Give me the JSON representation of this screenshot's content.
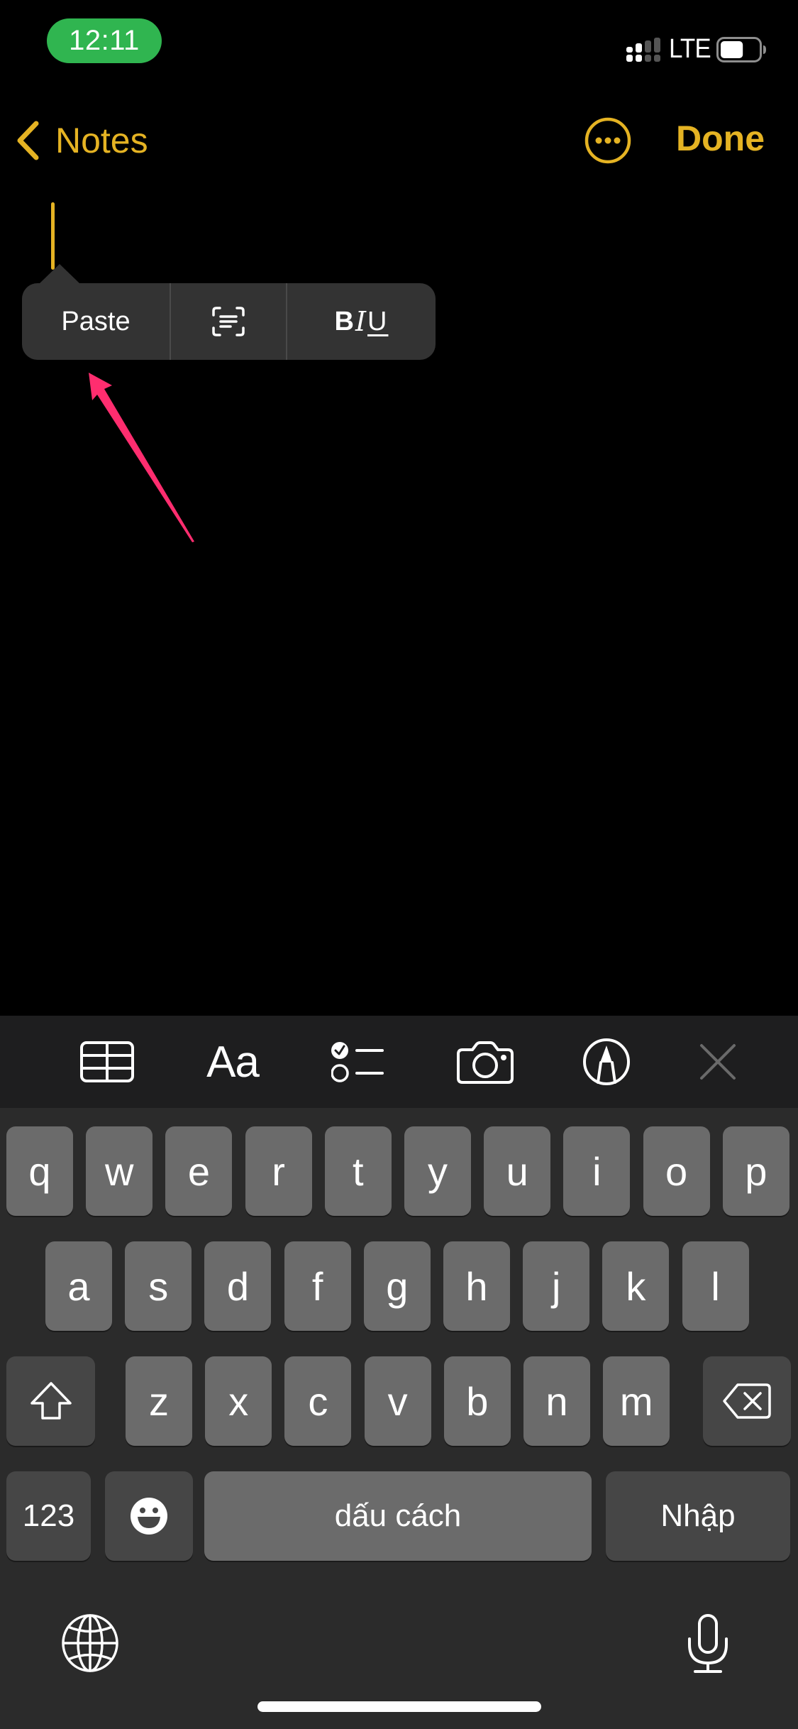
{
  "status_bar": {
    "time": "12:11",
    "network": "LTE",
    "signal_bars_active": 2,
    "signal_bars_total": 4,
    "battery_level": 0.6,
    "time_pill_color": "#30b550"
  },
  "nav": {
    "back_label": "Notes",
    "back_icon": "chevron-left-icon",
    "more_icon": "ellipsis-circle-icon",
    "done_label": "Done",
    "accent_color": "#e5b323"
  },
  "edit_menu": {
    "paste_label": "Paste",
    "scan_text_icon": "scan-text-icon",
    "format": {
      "bold": "B",
      "italic": "I",
      "underline": "U"
    }
  },
  "annotation": {
    "arrow_color": "#ff2d6f",
    "points_to": "Paste"
  },
  "format_toolbar": {
    "items": [
      {
        "name": "table",
        "icon": "table-icon"
      },
      {
        "name": "text-style",
        "label": "Aa"
      },
      {
        "name": "checklist",
        "icon": "checklist-icon"
      },
      {
        "name": "camera",
        "icon": "camera-icon"
      },
      {
        "name": "markup",
        "icon": "markup-pen-icon"
      },
      {
        "name": "close",
        "icon": "close-icon"
      }
    ]
  },
  "keyboard": {
    "row1": [
      "q",
      "w",
      "e",
      "r",
      "t",
      "y",
      "u",
      "i",
      "o",
      "p"
    ],
    "row2": [
      "a",
      "s",
      "d",
      "f",
      "g",
      "h",
      "j",
      "k",
      "l"
    ],
    "row3": [
      "z",
      "x",
      "c",
      "v",
      "b",
      "n",
      "m"
    ],
    "numbers_label": "123",
    "space_label": "dấu cách",
    "return_label": "Nhập",
    "shift_icon": "shift-icon",
    "delete_icon": "delete-backspace-icon",
    "emoji_icon": "emoji-icon",
    "globe_icon": "globe-icon",
    "mic_icon": "microphone-icon"
  }
}
